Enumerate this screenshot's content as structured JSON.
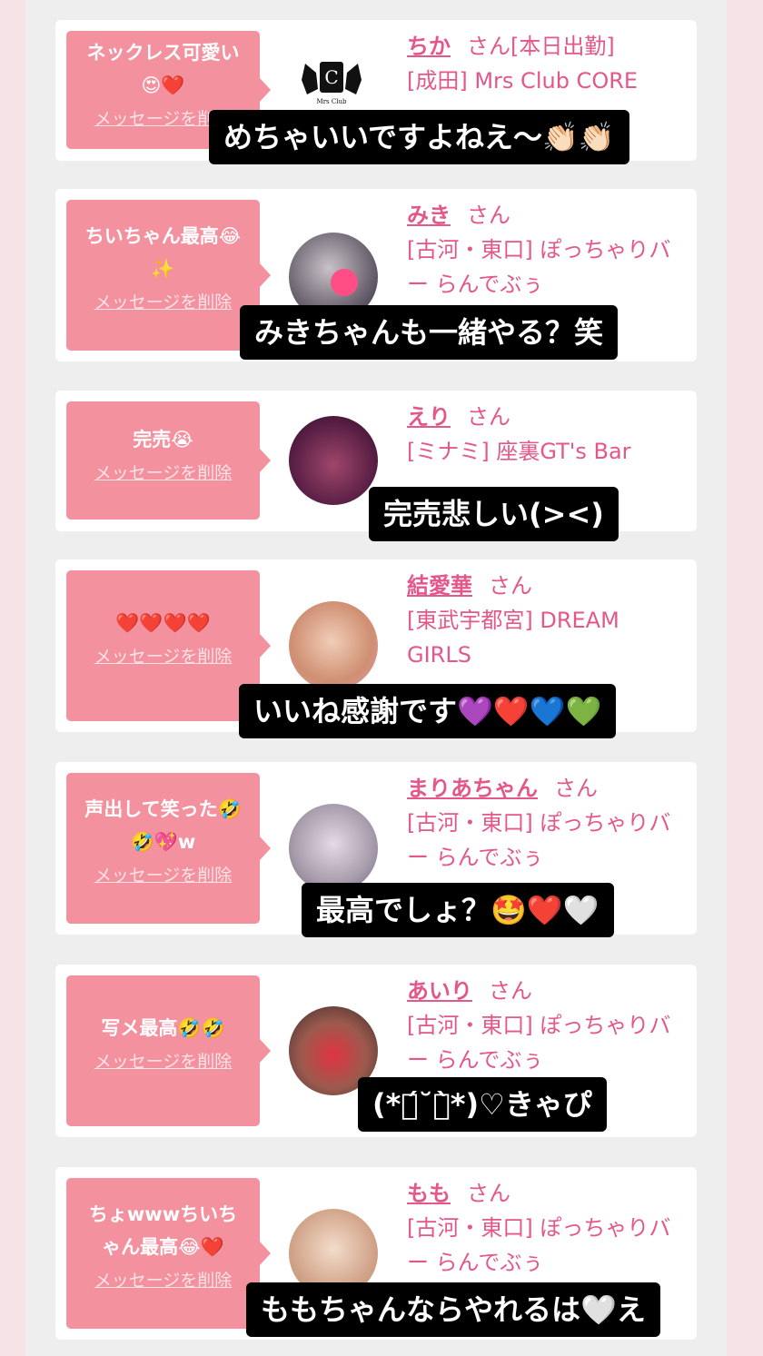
{
  "posts": [
    {
      "comment": "ネックレス可愛い\n😍❤️",
      "delete": "メッセージを削除",
      "name": "ちか",
      "san": "さん[本日出勤]",
      "shop": "[成田] Mrs Club CORE",
      "caption": "めちゃいいですよねえ〜👏🏻👏🏻"
    },
    {
      "comment": "ちいちゃん最高😂\n✨",
      "delete": "メッセージを削除",
      "name": "みき",
      "san": "さん",
      "shop": "[古河・東口] ぽっちゃりバー らんでぶぅ",
      "caption": "みきちゃんも一緒やる？笑"
    },
    {
      "comment": "完売😭",
      "delete": "メッセージを削除",
      "name": "えり",
      "san": "さん",
      "shop": "[ミナミ] 座裏GT's Bar",
      "caption": "完売悲しい(><)"
    },
    {
      "comment": "❤️❤️❤️❤️",
      "delete": "メッセージを削除",
      "name": "結愛華",
      "san": "さん",
      "shop": "[東武宇都宮] DREAM GIRLS",
      "caption": "いいね感謝です💜❤️💙💚"
    },
    {
      "comment": "声出して笑った🤣\n🤣💖w",
      "delete": "メッセージを削除",
      "name": "まりあちゃん",
      "san": "さん",
      "shop": "[古河・東口] ぽっちゃりバー らんでぶぅ",
      "caption": "最高でしょ？🤩❤️🤍"
    },
    {
      "comment": "写メ最高🤣🤣",
      "delete": "メッセージを削除",
      "name": "あいり",
      "san": "さん",
      "shop": "[古河・東口] ぽっちゃりバー らんでぶぅ",
      "caption": "(*ฅ́˘ฅ̀*)♡きゃぴ"
    },
    {
      "comment": "ちょwwwちいち\nゃん最高😂❤️",
      "delete": "メッセージを削除",
      "name": "もも",
      "san": "さん",
      "shop": "[古河・東口] ぽっちゃりバー らんでぶぅ",
      "caption": "ももちゃんならやれるは🤍え"
    }
  ],
  "logo_text": "Mrs Club",
  "colors": {
    "bubble": "#f4919f",
    "link": "#e4578b",
    "page_bg": "#efeeef"
  }
}
